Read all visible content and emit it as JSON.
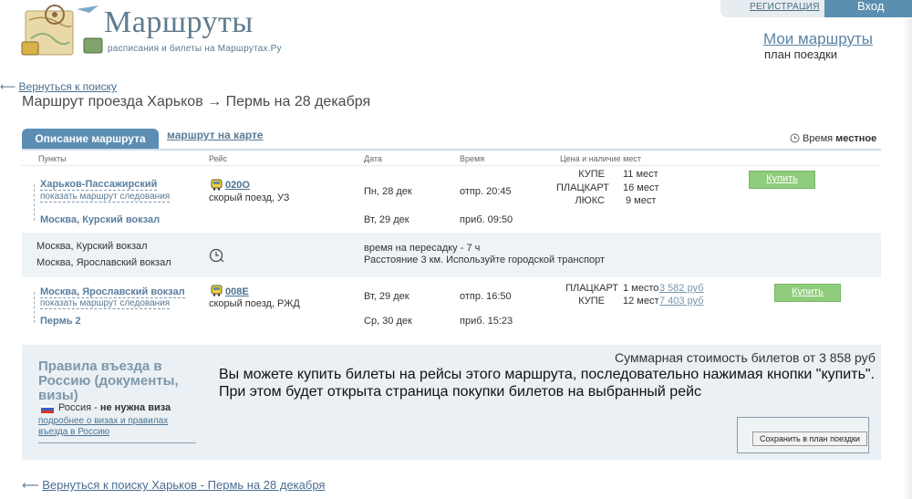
{
  "header": {
    "logo_title": "Маршруты",
    "logo_subtitle": "расписания и билеты на Маршрутах.Ру",
    "register_link": "РЕГИСТРАЦИЯ",
    "login_link": "Вход",
    "my_routes_link": "Мои маршруты",
    "trip_plan_label": "план поездки"
  },
  "nav": {
    "back_top": "Вернуться к поиску",
    "back_bottom": "Вернуться к поиску Харьков - Пермь на 28 декабря"
  },
  "page_title": "Маршрут проезда Харьков → Пермь на 28 декабря",
  "tabs": {
    "description": "Описание маршрута",
    "map": "маршрут на карте"
  },
  "time_note": {
    "prefix": "Время ",
    "value": "местное"
  },
  "columns": {
    "points": "Пункты",
    "trip": "Рейс",
    "date": "Дата",
    "time": "Время",
    "price": "Цена и наличие мест"
  },
  "segments": [
    {
      "from": "Харьков-Пассажирский",
      "show_route": "показать маршрут следования",
      "to": "Москва, Курский вокзал",
      "train_no": "020О",
      "train_desc": "скорый поезд, УЗ",
      "dep_date": "Пн, 28 дек",
      "dep_time": "отпр. 20:45",
      "arr_date": "Вт, 29 дек",
      "arr_time": "приб. 09:50",
      "seats": [
        {
          "class": "КУПЕ",
          "count": "11 мест",
          "price": ""
        },
        {
          "class": "ПЛАЦКАРТ",
          "count": "16 мест",
          "price": ""
        },
        {
          "class": "ЛЮКС",
          "count": "9 мест",
          "price": ""
        }
      ],
      "buy_label": "Купить"
    },
    {
      "from": "Москва, Ярославский вокзал",
      "show_route": "показать маршрут следования",
      "to": "Пермь 2",
      "train_no": "008Е",
      "train_desc": "скорый поезд, РЖД",
      "dep_date": "Вт, 29 дек",
      "dep_time": "отпр. 16:50",
      "arr_date": "Ср, 30 дек",
      "arr_time": "приб. 15:23",
      "seats": [
        {
          "class": "ПЛАЦКАРТ",
          "count": "1 место",
          "price": "3 582 руб"
        },
        {
          "class": "КУПЕ",
          "count": "12 мест",
          "price": "7 403 руб"
        }
      ],
      "buy_label": "Купить"
    }
  ],
  "transfer": {
    "from": "Москва, Курский вокзал",
    "to": "Москва, Ярославский вокзал",
    "wait": "время на пересадку - 7 ч",
    "distance": "Расстояние 3 км. Используйте городской транспорт"
  },
  "visa": {
    "title": "Правила въезда в Россию (документы, визы)",
    "country": "Россия",
    "status": "не нужна виза",
    "more_link": "подробнее о визах и правилах въезда в Россию"
  },
  "summary": {
    "total": "Суммарная стоимость билетов от 3 858 руб",
    "hint": "Вы можете купить билеты на рейсы этого маршрута, последовательно нажимая кнопки \"купить\". При этом будет открыта страница покупки билетов на выбранный рейс",
    "save_button": "Сохранить в план поездки"
  },
  "colors": {
    "tab_active": "#5b8eb2",
    "buy_button": "#8fcc7b",
    "link": "#4a7393",
    "panel_bg": "#eaf0f4"
  }
}
